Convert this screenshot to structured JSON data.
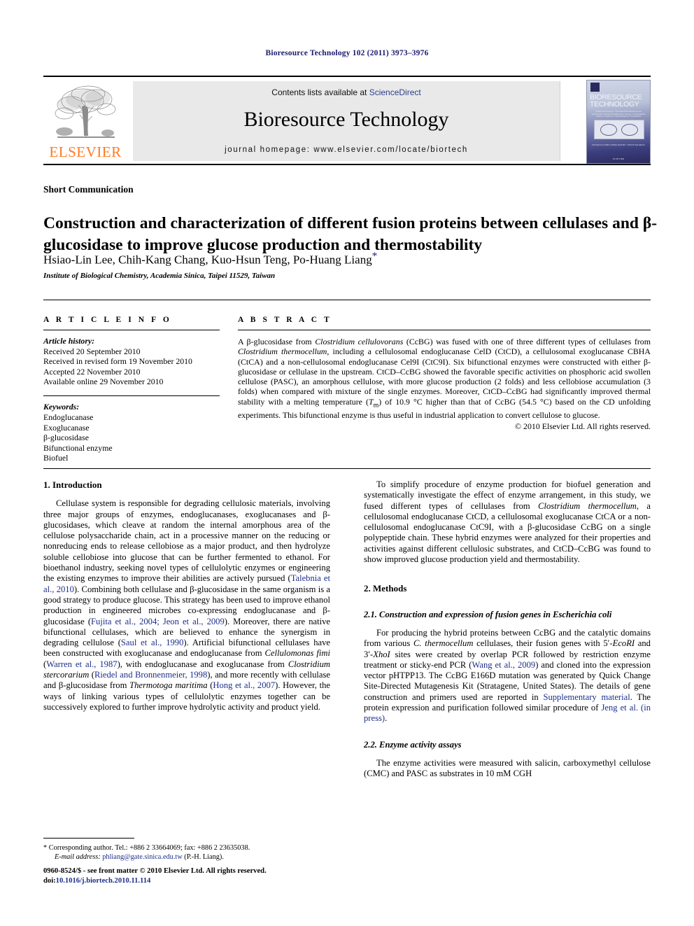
{
  "running_head": "Bioresource Technology 102 (2011) 3973–3976",
  "masthead": {
    "contents_prefix": "Contents lists available at ",
    "contents_link": "ScienceDirect",
    "journal_title": "Bioresource Technology",
    "homepage": "journal homepage: www.elsevier.com/locate/biortech",
    "publisher_logo_word": "ELSEVIER",
    "cover": {
      "title": "BIORESOURCE TECHNOLOGY",
      "subtitle": "applied microbiology • biochemical/biofuel/bioprocess technologies • biological engineering • biology • environmental sciences • bioprocess • thermochemical • biochemical",
      "footer_line1": "EDITOR-IN-CHIEF\nASHOK PANDEY / KEITH WALDRON",
      "footer_line2": "ELSEVIER"
    }
  },
  "article": {
    "section_type": "Short Communication",
    "title": "Construction and characterization of different fusion proteins between cellulases and β-glucosidase to improve glucose production and thermostability",
    "authors": "Hsiao-Lin Lee, Chih-Kang Chang, Kuo-Hsun Teng, Po-Huang Liang",
    "corresponding_marker": "*",
    "affiliation": "Institute of Biological Chemistry, Academia Sinica, Taipei 11529, Taiwan"
  },
  "article_info": {
    "heading": "A R T I C L E   I N F O",
    "history_label": "Article history:",
    "history": [
      "Received 20 September 2010",
      "Received in revised form 19 November 2010",
      "Accepted 22 November 2010",
      "Available online 29 November 2010"
    ],
    "keywords_label": "Keywords:",
    "keywords": [
      "Endoglucanase",
      "Exoglucanase",
      "β-glucosidase",
      "Bifunctional enzyme",
      "Biofuel"
    ]
  },
  "abstract": {
    "heading": "A B S T R A C T",
    "text": "A β-glucosidase from Clostridium cellulovorans (CcBG) was fused with one of three different types of cellulases from Clostridium thermocellum, including a cellulosomal endoglucanase CelD (CtCD), a cellulosomal exoglucanase CBHA (CtCA) and a non-cellulosomal endoglucanase Cel9I (CtC9I). Six bifunctional enzymes were constructed with either β-glucosidase or cellulase in the upstream. CtCD–CcBG showed the favorable specific activities on phosphoric acid swollen cellulose (PASC), an amorphous cellulose, with more glucose production (2 folds) and less cellobiose accumulation (3 folds) when compared with mixture of the single enzymes. Moreover, CtCD–CcBG had significantly improved thermal stability with a melting temperature (Tm) of 10.9 °C higher than that of CcBG (54.5 °C) based on the CD unfolding experiments. This bifunctional enzyme is thus useful in industrial application to convert cellulose to glucose.",
    "copyright": "© 2010 Elsevier Ltd. All rights reserved."
  },
  "body": {
    "intro_heading": "1. Introduction",
    "intro_p1": "Cellulase system is responsible for degrading cellulosic materials, involving three major groups of enzymes, endoglucanases, exoglucanases and β-glucosidases, which cleave at random the internal amorphous area of the cellulose polysaccharide chain, act in a processive manner on the reducing or nonreducing ends to release cellobiose as a major product, and then hydrolyze soluble cellobiose into glucose that can be further fermented to ethanol. For bioethanol industry, seeking novel types of cellulolytic enzymes or engineering the existing enzymes to improve their abilities are actively pursued (Talebnia et al., 2010). Combining both cellulase and β-glucosidase in the same organism is a good strategy to produce glucose. This strategy has been used to improve ethanol production in engineered microbes co-expressing endoglucanase and β-glucosidase (Fujita et al., 2004; Jeon et al., 2009). Moreover, there are native bifunctional cellulases, which are believed to enhance the synergism in degrading cellulose (Saul et al., 1990). Artificial bifunctional cellulases have been constructed with exoglucanase and endoglucanase from Cellulomonas fimi (Warren et al., 1987), with endoglucanase and exoglucanase from Clostridium stercorarium (Riedel and Bronnenmeier, 1998), and more recently with cellulase and β-glucosidase from Thermotoga maritima (Hong et al., 2007). However, the ways of linking various types of cellulolytic enzymes together can be successively explored to further improve hydrolytic activity and product yield.",
    "intro_p2": "To simplify procedure of enzyme production for biofuel generation and systematically investigate the effect of enzyme arrangement, in this study, we fused different types of cellulases from Clostridium thermocellum, a cellulosomal endoglucanase CtCD, a cellulosomal exoglucanase CtCA or a non-cellulosomal endoglucanase CtC9I, with a β-glucosidase CcBG on a single polypeptide chain. These hybrid enzymes were analyzed for their properties and activities against different cellulosic substrates, and CtCD–CcBG was found to show improved glucose production yield and thermostability.",
    "methods_heading": "2. Methods",
    "sub21_heading": "2.1. Construction and expression of fusion genes in Escherichia coli",
    "sub21_p1": "For producing the hybrid proteins between CcBG and the catalytic domains from various C. thermocellum cellulases, their fusion genes with 5′-EcoRI and 3′-XhoI sites were created by overlap PCR followed by restriction enzyme treatment or sticky-end PCR (Wang et al., 2009) and cloned into the expression vector pHTPP13. The CcBG E166D mutation was generated by Quick Change Site-Directed Mutagenesis Kit (Stratagene, United States). The details of gene construction and primers used are reported in Supplementary material. The protein expression and purification followed similar procedure of Jeng et al. (in press).",
    "sub22_heading": "2.2. Enzyme activity assays",
    "sub22_p1": "The enzyme activities were measured with salicin, carboxymethyl cellulose (CMC) and PASC as substrates in 10 mM CGH"
  },
  "footnote": {
    "marker": "*",
    "line1": "Corresponding author. Tel.: +886 2 33664069; fax: +886 2 23635038.",
    "email_label": "E-mail address:",
    "email": "phliang@gate.sinica.edu.tw",
    "email_suffix": "(P.-H. Liang)."
  },
  "page_footer": {
    "issn_line": "0960-8524/$ - see front matter © 2010 Elsevier Ltd. All rights reserved.",
    "doi_label": "doi:",
    "doi": "10.1016/j.biortech.2010.11.114"
  },
  "colors": {
    "link": "#1c2e8a",
    "runhead": "#1a1a6e",
    "elsevier_orange": "#ff7a21",
    "masthead_bg": "#e9e9e9"
  }
}
